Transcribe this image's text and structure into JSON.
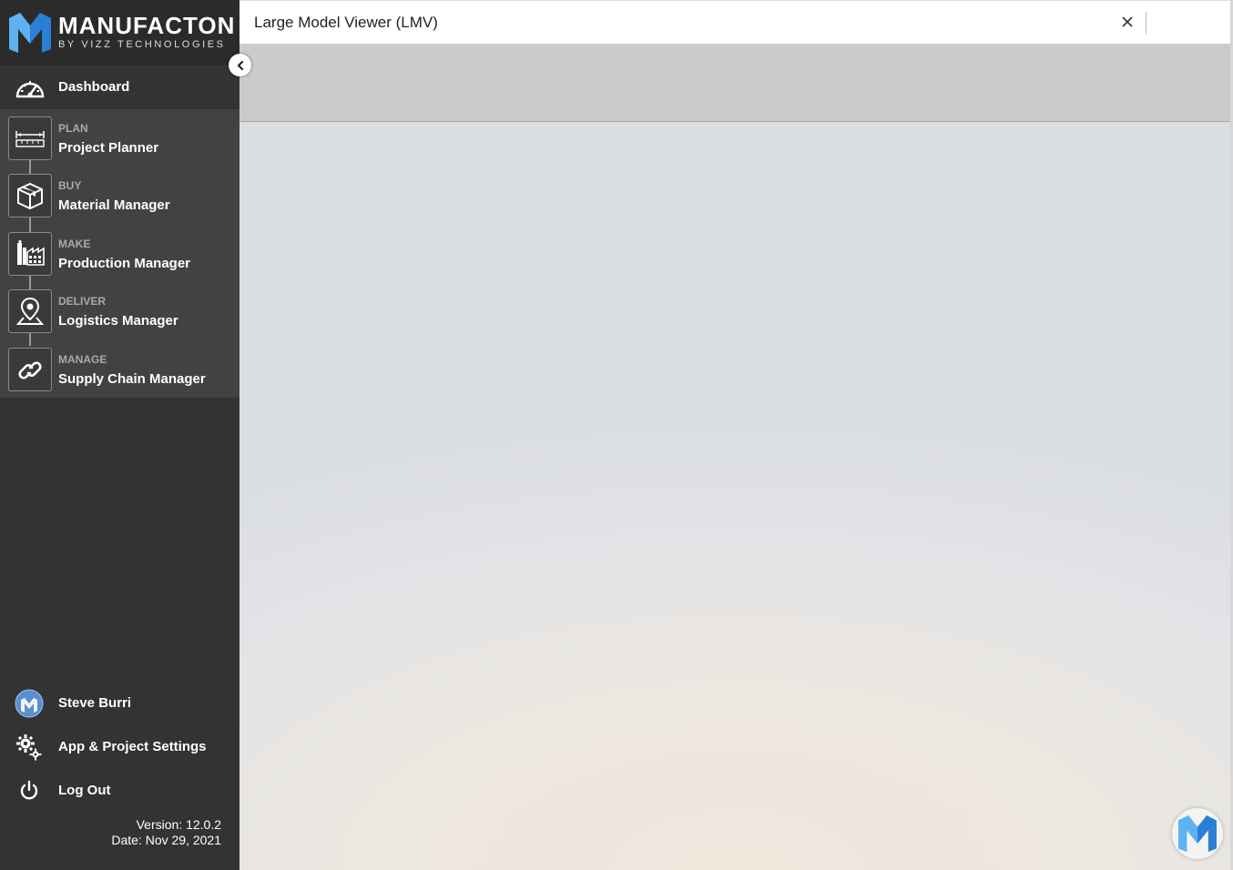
{
  "brand": {
    "name": "MANUFACTON",
    "subtitle": "BY VIZZ TECHNOLOGIES",
    "colors": {
      "blue": "#2a7fd6",
      "lightBlue": "#5fb2f0",
      "dark": "#333333"
    }
  },
  "sidebar": {
    "dashboard": {
      "label": "Dashboard",
      "icon": "gauge-icon"
    },
    "modules": [
      {
        "category": "PLAN",
        "label": "Project Planner",
        "icon": "ruler-icon"
      },
      {
        "category": "BUY",
        "label": "Material Manager",
        "icon": "box-icon"
      },
      {
        "category": "MAKE",
        "label": "Production Manager",
        "icon": "factory-icon"
      },
      {
        "category": "DELIVER",
        "label": "Logistics Manager",
        "icon": "map-pin-icon"
      },
      {
        "category": "MANAGE",
        "label": "Supply Chain Manager",
        "icon": "link-icon"
      }
    ],
    "user": {
      "name": "Steve Burri"
    },
    "settings": {
      "label": "App & Project Settings"
    },
    "logout": {
      "label": "Log Out"
    },
    "version": "Version: 12.0.2",
    "date": "Date: Nov 29, 2021"
  },
  "main": {
    "title": "Large Model Viewer (LMV)"
  }
}
